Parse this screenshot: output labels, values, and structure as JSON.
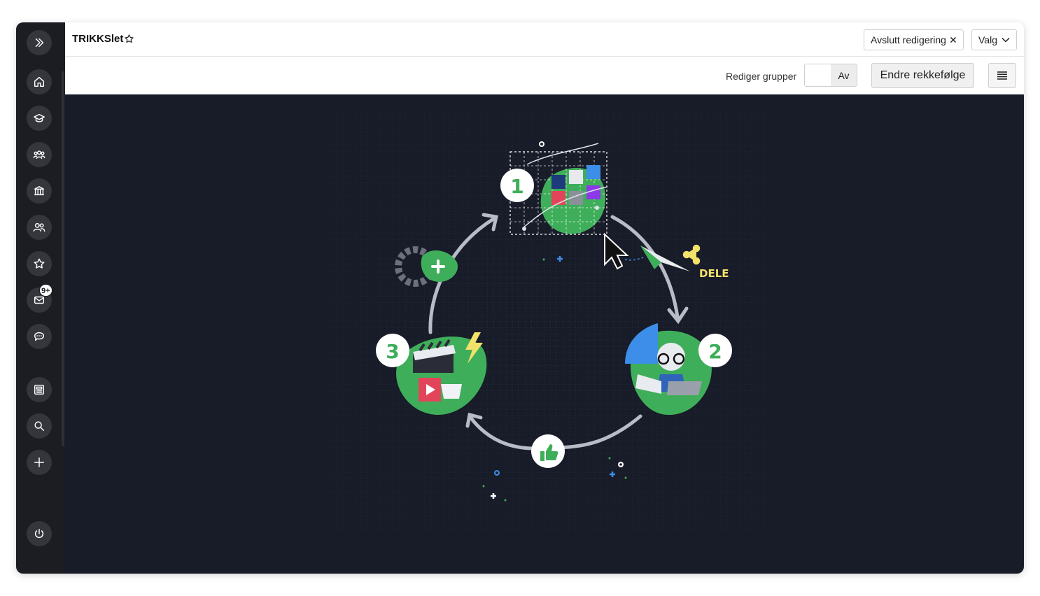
{
  "header": {
    "title": "TRIKKSlet"
  },
  "actions": {
    "finish_editing": "Avslutt redigering",
    "options": "Valg"
  },
  "toolbar": {
    "edit_groups_label": "Rediger grupper",
    "toggle_value": "Av",
    "reorder": "Endre rekkefølge"
  },
  "sidebar": {
    "mail_badge": "9+",
    "icons": [
      "expand-icon",
      "home-icon",
      "graduation-cap-icon",
      "users-group-icon",
      "institution-icon",
      "people-icon",
      "star-icon",
      "mail-icon",
      "chat-icon",
      "newspaper-icon",
      "search-icon",
      "plus-icon",
      "power-icon"
    ]
  },
  "illustration": {
    "steps": [
      "1",
      "2",
      "3"
    ],
    "share_label": "DELE"
  },
  "colors": {
    "sidebar": "#1b1d22",
    "canvas": "#181b28",
    "green": "#3fae5a",
    "blue": "#3d8ee8",
    "yellow": "#f2e26a"
  }
}
